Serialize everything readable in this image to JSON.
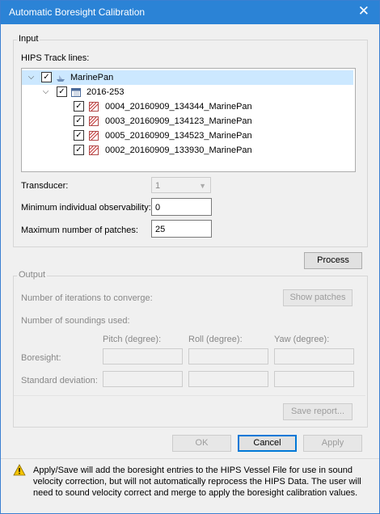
{
  "window": {
    "title": "Automatic Boresight Calibration"
  },
  "input": {
    "label": "Input",
    "tracklines_label": "HIPS Track lines:",
    "tree": {
      "vessel": "MarinePan",
      "day": "2016-253",
      "lines": [
        "0004_20160909_134344_MarinePan",
        "0003_20160909_134123_MarinePan",
        "0005_20160909_134523_MarinePan",
        "0002_20160909_133930_MarinePan"
      ]
    },
    "transducer_label": "Transducer:",
    "transducer_value": "1",
    "min_obs_label": "Minimum individual observability:",
    "min_obs_value": "0",
    "max_patches_label": "Maximum number of patches:",
    "max_patches_value": "25"
  },
  "process_button": "Process",
  "output": {
    "label": "Output",
    "iterations_label": "Number of iterations to converge:",
    "show_patches_button": "Show patches",
    "soundings_label": "Number of soundings used:",
    "columns": [
      "Pitch (degree):",
      "Roll (degree):",
      "Yaw (degree):"
    ],
    "rows": [
      "Boresight:",
      "Standard deviation:"
    ],
    "save_report_button": "Save report..."
  },
  "buttons": {
    "ok": "OK",
    "cancel": "Cancel",
    "apply": "Apply"
  },
  "note": "Apply/Save will add the boresight entries to the HIPS Vessel File for use in sound velocity correction, but will not automatically reprocess the HIPS Data. The user will need to sound velocity correct and merge to apply the boresight calibration values.",
  "colors": {
    "titlebar": "#2b83d6",
    "selection": "#cce8ff",
    "default_button_border": "#0078d7"
  }
}
